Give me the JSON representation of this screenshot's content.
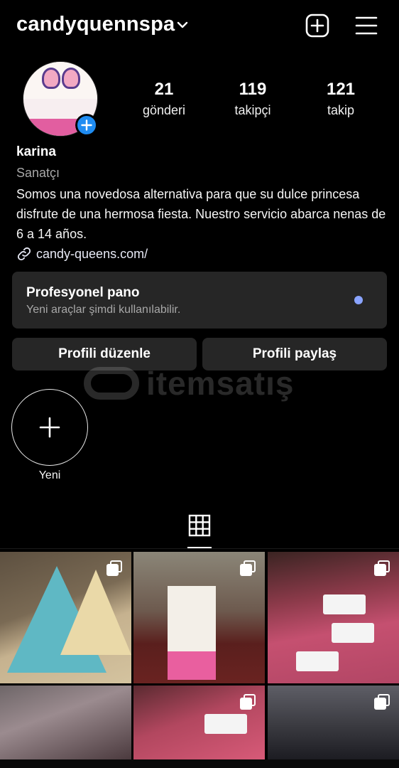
{
  "header": {
    "username": "candyquennspa",
    "chevron_icon": "chevron-down-icon",
    "add_icon": "plus-square-icon",
    "menu_icon": "hamburger-menu-icon"
  },
  "profile": {
    "avatar_icon": "profile-photo",
    "add_story_icon": "plus-circle-icon",
    "stats": [
      {
        "value": "21",
        "label": "gönderi"
      },
      {
        "value": "119",
        "label": "takipçi"
      },
      {
        "value": "121",
        "label": "takip"
      }
    ],
    "name": "karina",
    "category": "Sanatçı",
    "bio": "Somos una novedosa alternativa para que su dulce princesa disfrute de una hermosa fiesta. Nuestro servicio abarca nenas de 6 a 14 años.",
    "link": "candy-queens.com/",
    "link_icon": "link-icon"
  },
  "dashboard": {
    "title": "Profesyonel pano",
    "subtitle": "Yeni araçlar şimdi kullanılabilir.",
    "dot_color": "#8aa4ff"
  },
  "actions": {
    "edit": "Profili düzenle",
    "share": "Profili paylaş"
  },
  "highlights": {
    "new_label": "Yeni",
    "new_icon": "plus-icon"
  },
  "tabs": {
    "grid_icon": "grid-icon"
  },
  "posts": [
    {
      "icon": "multi-photo-icon",
      "multi": true
    },
    {
      "icon": "multi-photo-icon",
      "multi": true
    },
    {
      "icon": "multi-photo-icon",
      "multi": true
    },
    {
      "icon": "",
      "multi": false
    },
    {
      "icon": "multi-photo-icon",
      "multi": true
    },
    {
      "icon": "multi-photo-icon",
      "multi": true
    }
  ],
  "colors": {
    "background": "#000000",
    "card": "#262626",
    "accent_blue": "#1f8cf2"
  }
}
